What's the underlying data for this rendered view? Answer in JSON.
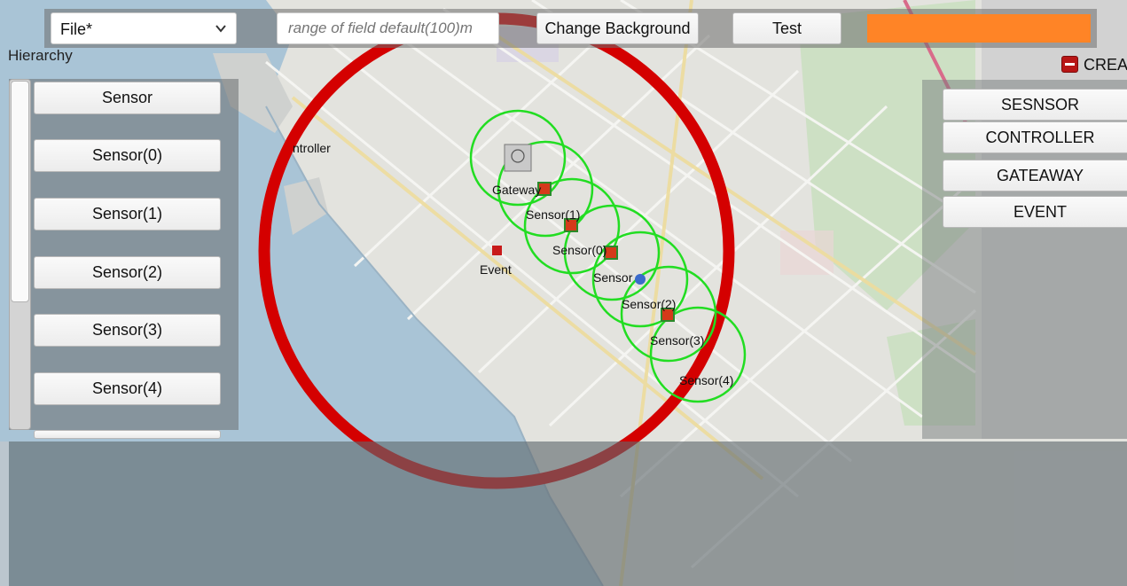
{
  "toolbar": {
    "file_select_value": "File*",
    "range_placeholder": "range of field default(100)m",
    "change_background_label": "Change Background",
    "test_label": "Test",
    "accent_color": "#ff8426"
  },
  "hierarchy": {
    "label": "Hierarchy",
    "items": [
      {
        "label": "Sensor"
      },
      {
        "label": "Sensor(0)"
      },
      {
        "label": "Sensor(1)"
      },
      {
        "label": "Sensor(2)"
      },
      {
        "label": "Sensor(3)"
      },
      {
        "label": "Sensor(4)"
      }
    ]
  },
  "create_panel": {
    "label": "CREA",
    "buttons": [
      {
        "label": "SESNSOR"
      },
      {
        "label": "CONTROLLER"
      },
      {
        "label": "GATEAWAY"
      },
      {
        "label": "EVENT"
      }
    ]
  },
  "map": {
    "labels": {
      "controller": "ntroller",
      "gateway": "Gateway",
      "event": "Event",
      "sensor": "Sensor",
      "sensor0": "Sensor(0)",
      "sensor1": "Sensor(1)",
      "sensor2": "Sensor(2)",
      "sensor3": "Sensor(3)",
      "sensor4": "Sensor(4)"
    },
    "field_color": "#d40000",
    "range_color": "#22dd22"
  }
}
